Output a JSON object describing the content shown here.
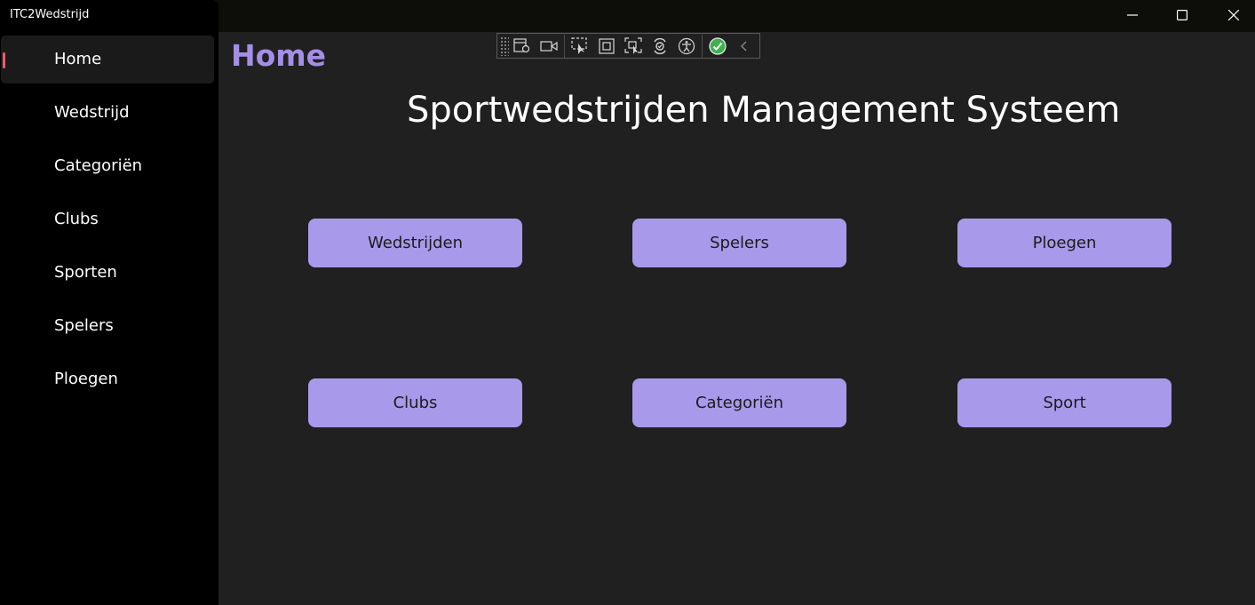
{
  "window": {
    "title": "ITC2Wedstrijd"
  },
  "titlebar_buttons": [
    {
      "name": "minimize-button",
      "icon": "minimize-icon"
    },
    {
      "name": "maximize-button",
      "icon": "maximize-icon"
    },
    {
      "name": "close-button",
      "icon": "close-icon"
    }
  ],
  "sidebar": {
    "selected_index": 0,
    "items": [
      {
        "label": "Home"
      },
      {
        "label": "Wedstrijd"
      },
      {
        "label": "Categoriën"
      },
      {
        "label": "Clubs"
      },
      {
        "label": "Sporten"
      },
      {
        "label": "Spelers"
      },
      {
        "label": "Ploegen"
      }
    ]
  },
  "page": {
    "title": "Home",
    "heading": "Sportwedstrijden Management Systeem"
  },
  "tiles": [
    {
      "label": "Wedstrijden"
    },
    {
      "label": "Spelers"
    },
    {
      "label": "Ploegen"
    },
    {
      "label": "Clubs"
    },
    {
      "label": "Categoriën"
    },
    {
      "label": "Sport"
    }
  ],
  "debug_toolbar": {
    "icons": [
      "live-visual-tree-icon",
      "record-icon",
      "select-element-icon",
      "display-layout-adorners-icon",
      "track-focus-icon",
      "hot-reload-icon",
      "accessibility-icon",
      "checked-icon",
      "collapse-chevron-icon"
    ]
  },
  "colors": {
    "accent": "#a48fe6",
    "tile_background": "#a999ea",
    "selection_indicator": "#ea5f6a",
    "sidebar_background": "#000000",
    "content_background": "#202020"
  }
}
